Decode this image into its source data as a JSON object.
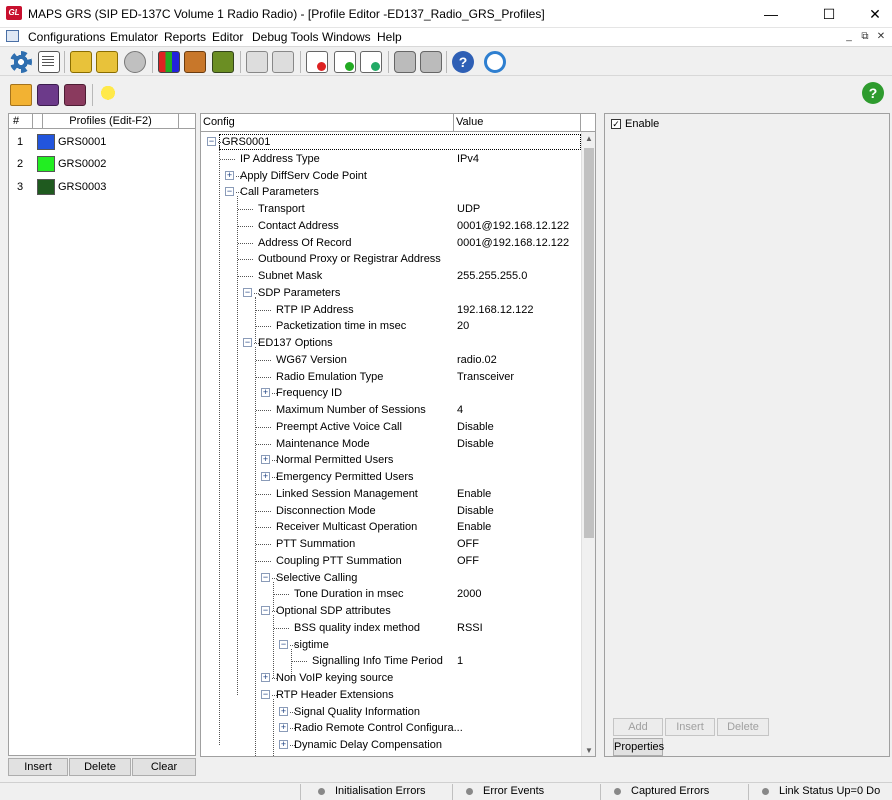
{
  "window": {
    "title": "MAPS GRS (SIP ED-137C Volume 1 Radio Radio) - [Profile Editor -ED137_Radio_GRS_Profiles]",
    "app_icon_text": "GL"
  },
  "menu": [
    "Configurations",
    "Emulator",
    "Reports",
    "Editor",
    "Debug Tools",
    "Windows",
    "Help"
  ],
  "profiles": {
    "header_num": "#",
    "header_name": "Profiles (Edit-F2)",
    "items": [
      {
        "num": "1",
        "name": "GRS0001",
        "color": "#2255dd"
      },
      {
        "num": "2",
        "name": "GRS0002",
        "color": "#22ee22"
      },
      {
        "num": "3",
        "name": "GRS0003",
        "color": "#1f5a1f"
      }
    ],
    "buttons": {
      "insert": "Insert",
      "delete": "Delete",
      "clear": "Clear"
    }
  },
  "tree": {
    "header_config": "Config",
    "header_value": "Value",
    "rows": [
      {
        "label": "GRS0001",
        "value": ""
      },
      {
        "label": "IP Address Type",
        "value": "IPv4"
      },
      {
        "label": "Apply DiffServ Code Point",
        "value": ""
      },
      {
        "label": "Call Parameters",
        "value": ""
      },
      {
        "label": "Transport",
        "value": "UDP"
      },
      {
        "label": "Contact Address",
        "value": "0001@192.168.12.122"
      },
      {
        "label": "Address Of Record",
        "value": "0001@192.168.12.122"
      },
      {
        "label": "Outbound Proxy or Registrar Address",
        "value": ""
      },
      {
        "label": "Subnet Mask",
        "value": "255.255.255.0"
      },
      {
        "label": "SDP Parameters",
        "value": ""
      },
      {
        "label": "RTP IP Address",
        "value": "192.168.12.122"
      },
      {
        "label": "Packetization time in msec",
        "value": "20"
      },
      {
        "label": "ED137 Options",
        "value": ""
      },
      {
        "label": "WG67 Version",
        "value": "radio.02"
      },
      {
        "label": "Radio Emulation Type",
        "value": "Transceiver"
      },
      {
        "label": "Frequency ID",
        "value": ""
      },
      {
        "label": "Maximum Number of Sessions",
        "value": "4"
      },
      {
        "label": "Preempt Active Voice Call",
        "value": "Disable"
      },
      {
        "label": "Maintenance Mode",
        "value": "Disable"
      },
      {
        "label": "Normal Permitted Users",
        "value": ""
      },
      {
        "label": "Emergency Permitted Users",
        "value": ""
      },
      {
        "label": "Linked Session Management",
        "value": "Enable"
      },
      {
        "label": "Disconnection Mode",
        "value": "Disable"
      },
      {
        "label": "Receiver Multicast Operation",
        "value": "Enable"
      },
      {
        "label": "PTT Summation",
        "value": "OFF"
      },
      {
        "label": "Coupling PTT Summation",
        "value": "OFF"
      },
      {
        "label": "Selective Calling",
        "value": ""
      },
      {
        "label": "Tone Duration in msec",
        "value": "2000"
      },
      {
        "label": "Optional SDP attributes",
        "value": ""
      },
      {
        "label": "BSS quality index method",
        "value": "RSSI"
      },
      {
        "label": "sigtime",
        "value": ""
      },
      {
        "label": "Signalling Info Time Period",
        "value": "1"
      },
      {
        "label": "Non VoIP keying source",
        "value": ""
      },
      {
        "label": "RTP Header Extensions",
        "value": ""
      },
      {
        "label": "Signal Quality Information",
        "value": ""
      },
      {
        "label": "Radio Remote Control Configura...",
        "value": ""
      },
      {
        "label": "Dynamic Delay Compensation",
        "value": ""
      }
    ]
  },
  "right_panel": {
    "enable_label": "Enable",
    "enable_checked": true,
    "buttons": {
      "add": "Add",
      "insert": "Insert",
      "delete": "Delete",
      "properties": "Properties"
    }
  },
  "status": {
    "items": [
      "Initialisation Errors",
      "Error Events",
      "Captured Errors",
      "Link Status Up=0 Do"
    ]
  }
}
